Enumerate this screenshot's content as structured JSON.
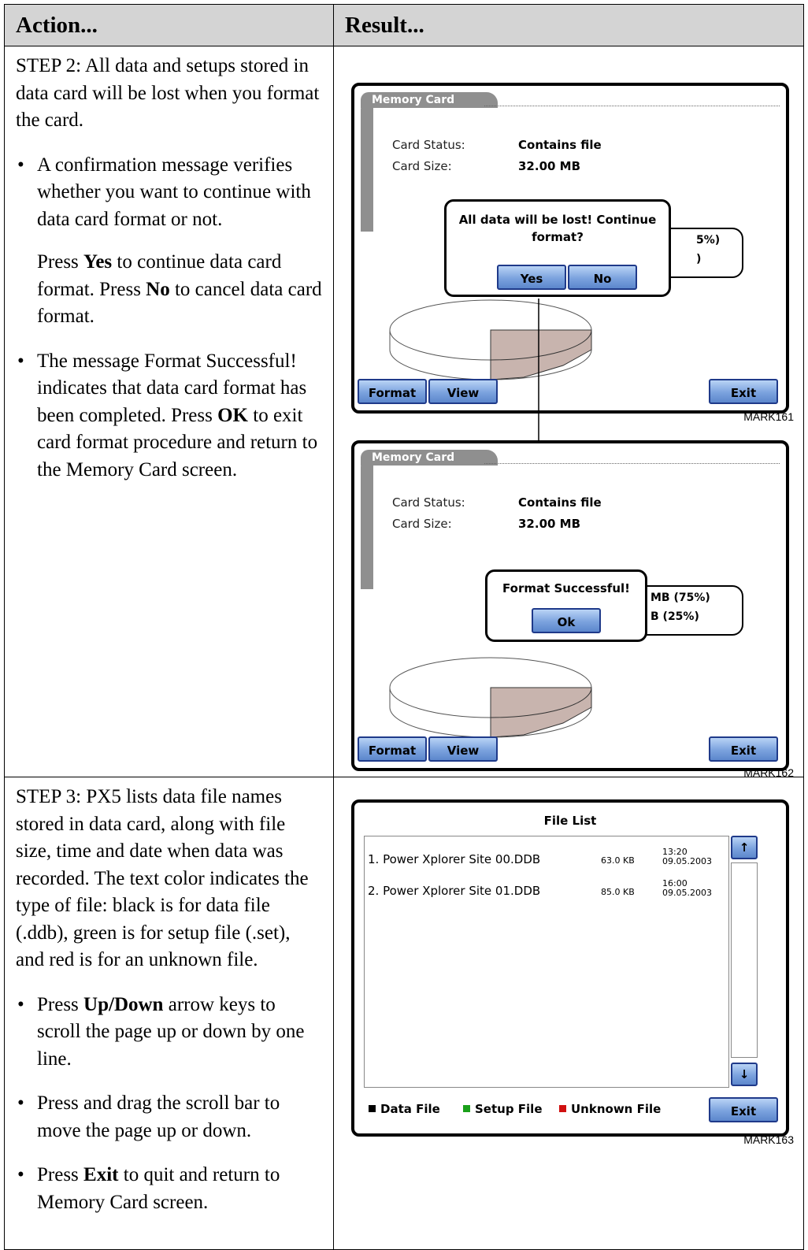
{
  "header": {
    "col1": "Action...",
    "col2": "Result..."
  },
  "step2": {
    "intro": "STEP 2: All data and setups stored in data card will be lost when you format the card.",
    "bullet1": "A confirmation message verifies whether you want to continue with data card format or not.",
    "press_yes_pre": "Press ",
    "yes": "Yes",
    "press_yes_mid": " to continue data card format. Press ",
    "no": "No",
    "press_yes_post": " to cancel data card format.",
    "bullet2_pre": "The message Format Successful! indicates that data card format has been completed. Press ",
    "ok": "OK",
    "bullet2_post": " to exit card format procedure and return to the Memory Card screen."
  },
  "step3": {
    "intro": "STEP 3: PX5 lists data file names stored in data card, along with file size, time and date when data was recorded. The text color indicates the type of file: black is for data file (.ddb), green is for setup file (.set), and red is for an unknown file.",
    "b1_pre": "Press ",
    "b1_bold": "Up/Down",
    "b1_post": " arrow keys to scroll the page up or down by one line.",
    "b2": "Press and drag the scroll bar to move the page up or down.",
    "b3_pre": "Press ",
    "b3_bold": "Exit",
    "b3_post": " to quit and return to Memory Card screen."
  },
  "screen1": {
    "tab": "Memory Card",
    "status_label": "Card Status:",
    "status_value": "Contains file",
    "size_label": "Card Size:",
    "size_value": "32.00 MB",
    "info_line1": "5%)",
    "info_line2": ")",
    "dialog_line1": "All data will be lost! Continue",
    "dialog_line2": "format?",
    "yes_button": "Yes",
    "no_button": "No",
    "format_button": "Format",
    "view_button": "View",
    "exit_button": "Exit",
    "mark": "MARK161"
  },
  "screen2": {
    "tab": "Memory Card",
    "status_label": "Card Status:",
    "status_value": "Contains file",
    "size_label": "Card Size:",
    "size_value": "32.00 MB",
    "info_line1": "MB (75%)",
    "info_line2": "B (25%)",
    "dialog_text": "Format Successful!",
    "ok_button": "Ok",
    "format_button": "Format",
    "view_button": "View",
    "exit_button": "Exit",
    "mark": "MARK162"
  },
  "screen3": {
    "title": "File List",
    "files": [
      {
        "name": "1. Power Xplorer Site 00.DDB",
        "size": "63.0 KB",
        "time": "13:20",
        "date": "09.05.2003"
      },
      {
        "name": "2. Power Xplorer Site 01.DDB",
        "size": "85.0 KB",
        "time": "16:00",
        "date": "09.05.2003"
      }
    ],
    "up_arrow": "↑",
    "down_arrow": "↓",
    "legend_data": "Data File",
    "legend_setup": "Setup File",
    "legend_unknown": "Unknown File",
    "exit_button": "Exit",
    "mark": "MARK163",
    "colors": {
      "data": "#000000",
      "setup": "#1aa01a",
      "unknown": "#d01010"
    }
  }
}
